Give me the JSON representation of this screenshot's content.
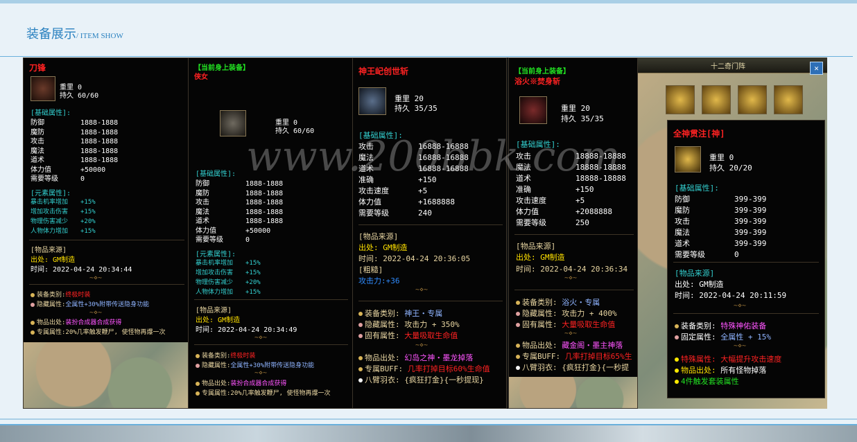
{
  "header": {
    "title": "装备展示",
    "subtitle": "/ ITEM SHOW"
  },
  "watermark": "www.200bbk.com",
  "panels": {
    "p1": {
      "name": "刀锋",
      "weight": "重里 0",
      "durability": "持久 60/60",
      "base_header": "[基础属性]:",
      "base_stats": [
        {
          "k": "防御",
          "v": "1888-1888"
        },
        {
          "k": "魔防",
          "v": "1888-1888"
        },
        {
          "k": "攻击",
          "v": "1888-1888"
        },
        {
          "k": "魔法",
          "v": "1888-1888"
        },
        {
          "k": "道术",
          "v": "1888-1888"
        },
        {
          "k": "体力值",
          "v": "+50000"
        },
        {
          "k": "需要等级",
          "v": "0"
        }
      ],
      "elem_header": "[元素属性]:",
      "elem_stats": [
        {
          "k": "暴击机率增加",
          "v": "+15%"
        },
        {
          "k": "增加攻击伤害",
          "v": "+15%"
        },
        {
          "k": "物理伤害减少",
          "v": "+20%"
        },
        {
          "k": "人物体力增加",
          "v": "+15%"
        }
      ],
      "source_header": "[物品来源]",
      "source": "出处: GM制造",
      "time": "时间: 2022-04-24 20:34:44",
      "equip_type_k": "装备类别:",
      "equip_type_v": "终极时装",
      "hidden_k": "隐藏属性:",
      "hidden_v": "全属性+30%附带传送隐身功能",
      "origin_k": "物品出处:",
      "origin_v": "装扮合成器合成获得",
      "special_k": "专属属性:",
      "special_v": "20%几率触发鞭尸, 使怪物再爆一次"
    },
    "p2": {
      "current": "【当前身上装备】",
      "name": "侠女",
      "weight": "重里 0",
      "durability": "持久 60/60",
      "base_header": "[基础属性]:",
      "base_stats": [
        {
          "k": "防御",
          "v": "1888-1888"
        },
        {
          "k": "魔防",
          "v": "1888-1888"
        },
        {
          "k": "攻击",
          "v": "1888-1888"
        },
        {
          "k": "魔法",
          "v": "1888-1888"
        },
        {
          "k": "道术",
          "v": "1888-1888"
        },
        {
          "k": "体力值",
          "v": "+50000"
        },
        {
          "k": "需要等级",
          "v": "0"
        }
      ],
      "elem_header": "[元素属性]:",
      "elem_stats": [
        {
          "k": "暴击机率增加",
          "v": "+15%"
        },
        {
          "k": "增加攻击伤害",
          "v": "+15%"
        },
        {
          "k": "物理伤害减少",
          "v": "+20%"
        },
        {
          "k": "人物体力增加",
          "v": "+15%"
        }
      ],
      "source_header": "[物品来源]",
      "source": "出处: GM制造",
      "time": "时间: 2022-04-24 20:34:49",
      "equip_type_k": "装备类别:",
      "equip_type_v": "终极时装",
      "hidden_k": "隐藏属性:",
      "hidden_v": "全属性+30%附带传送隐身功能",
      "origin_k": "物品出处:",
      "origin_v": "装扮合成器合成获得",
      "special_k": "专属属性:",
      "special_v": "20%几率触发鞭尸, 使怪物再爆一次"
    },
    "p3": {
      "name": "神王屺创世斩",
      "weight": "重里 20",
      "durability": "持久 35/35",
      "base_header": "[基础属性]:",
      "base_stats": [
        {
          "k": "攻击",
          "v": "16888-16888"
        },
        {
          "k": "魔法",
          "v": "16888-16888"
        },
        {
          "k": "道术",
          "v": "16888-16888"
        },
        {
          "k": "准确",
          "v": "+150"
        },
        {
          "k": "攻击速度",
          "v": "+5"
        },
        {
          "k": "体力值",
          "v": "+1688888"
        },
        {
          "k": "需要等级",
          "v": "240"
        }
      ],
      "source_header": "[物品来源]",
      "source": "出处: GM制造",
      "time": "时间: 2022-04-24 20:36:05",
      "rough": "[粗糙]",
      "atk_power": "攻击力:+36",
      "equip_type_k": "装备类别:",
      "equip_type_v": "神王・专属",
      "hidden_k": "隐藏属性:",
      "hidden_v": "攻击力 + 350%",
      "inherent_k": "固有属性:",
      "inherent_v": "大量吸取生命值",
      "origin_k": "物品出处:",
      "origin_v": "幻岛之神・墨龙掉落",
      "buff_k": "专属BUFF:",
      "buff_v": "几率打掉目标60%生命值",
      "wing_k": "八臂羽衣:",
      "wing_v": "{疯狂打金}{一秒提现}"
    },
    "p4": {
      "current": "【当前身上装备】",
      "name": "浴火※焚身斩",
      "weight": "重里 20",
      "durability": "持久 35/35",
      "base_header": "[基础属性]:",
      "base_stats": [
        {
          "k": "攻击",
          "v": "18888-18888"
        },
        {
          "k": "魔法",
          "v": "18888-18888"
        },
        {
          "k": "道术",
          "v": "18888-18888"
        },
        {
          "k": "准确",
          "v": "+150"
        },
        {
          "k": "攻击速度",
          "v": "+5"
        },
        {
          "k": "体力值",
          "v": "+2088888"
        },
        {
          "k": "需要等级",
          "v": "250"
        }
      ],
      "source_header": "[物品来源]",
      "source": "出处: GM制造",
      "time": "时间: 2022-04-24 20:36:34",
      "equip_type_k": "装备类别:",
      "equip_type_v": "浴火・专属",
      "hidden_k": "隐藏属性:",
      "hidden_v": "攻击力 + 400%",
      "inherent_k": "固有属性:",
      "inherent_v": "大量吸取生命值",
      "origin_k": "物品出处:",
      "origin_v": "藏金阁・墨主神落",
      "buff_k": "专属BUFF:",
      "buff_v": "几率打掉目标65%生",
      "wing_k": "八臂羽衣:",
      "wing_v": "{疯狂打金}{一秒提"
    },
    "p5": {
      "window_title": "十二奇门阵",
      "close": "✕",
      "name": "全神贯注[神]",
      "weight": "重里 0",
      "durability": "持久 20/20",
      "base_header": "[基础属性]:",
      "base_stats": [
        {
          "k": "防御",
          "v": "399-399"
        },
        {
          "k": "魔防",
          "v": "399-399"
        },
        {
          "k": "攻击",
          "v": "399-399"
        },
        {
          "k": "魔法",
          "v": "399-399"
        },
        {
          "k": "道术",
          "v": "399-399"
        },
        {
          "k": "需要等级",
          "v": "0"
        }
      ],
      "source_header": "[物品来源]",
      "source": "出处: GM制造",
      "time": "时间: 2022-04-24 20:11:59",
      "equip_type_k": "装备类别:",
      "equip_type_v": "特殊神佑装备",
      "fixed_k": "固定属性:",
      "fixed_v": "全属性 + 15%",
      "special_k": "特殊属性:",
      "special_v": "大幅提升攻击速度",
      "origin_k": "物品出处:",
      "origin_v": "所有怪物掉落",
      "set_note": "4件触发套装属性"
    }
  }
}
